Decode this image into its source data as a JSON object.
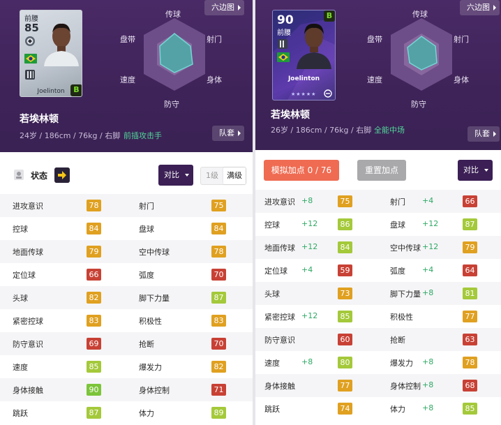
{
  "colors": {
    "hero_bg": "#3e2358",
    "role_green": "#52d69a",
    "boost_green": "#2ea864",
    "tier_red": "#c84135",
    "tier_orange": "#e0a020",
    "tier_yellow_green": "#a4c93a",
    "tier_green": "#7cc43a",
    "tier_teal": "#3cbf6e",
    "sim_button": "#ef6b52",
    "compare_button": "#3b1f55"
  },
  "left": {
    "hexagon_button": "六边图",
    "kit_button": "队套",
    "radar_labels": {
      "top": "传球",
      "top_left": "盘带",
      "top_right": "射门",
      "bottom_left": "速度",
      "bottom_right": "身体",
      "bottom": "防守"
    },
    "card": {
      "position": "前腰",
      "rating": "85",
      "name": "Joelinton",
      "badge": "B",
      "club_icon": "club-crest-icon",
      "flag_icon": "brazil-flag-icon"
    },
    "player_name": "若埃林顿",
    "meta": "24岁 / 186cm / 76kg / 右脚",
    "role": "前插攻击手",
    "state_label": "状态",
    "compare_label": "对比",
    "level_options": [
      "1级",
      "满级"
    ],
    "stats": [
      [
        {
          "name": "进攻意识",
          "value": "78",
          "tier": "#e0a020"
        },
        {
          "name": "射门",
          "value": "75",
          "tier": "#e0a020"
        }
      ],
      [
        {
          "name": "控球",
          "value": "84",
          "tier": "#e0a020"
        },
        {
          "name": "盘球",
          "value": "84",
          "tier": "#e0a020"
        }
      ],
      [
        {
          "name": "地面传球",
          "value": "79",
          "tier": "#e0a020"
        },
        {
          "name": "空中传球",
          "value": "78",
          "tier": "#e0a020"
        }
      ],
      [
        {
          "name": "定位球",
          "value": "66",
          "tier": "#c84135"
        },
        {
          "name": "弧度",
          "value": "70",
          "tier": "#c84135"
        }
      ],
      [
        {
          "name": "头球",
          "value": "82",
          "tier": "#e0a020"
        },
        {
          "name": "脚下力量",
          "value": "87",
          "tier": "#a4c93a"
        }
      ],
      [
        {
          "name": "紧密控球",
          "value": "83",
          "tier": "#e0a020"
        },
        {
          "name": "积极性",
          "value": "83",
          "tier": "#e0a020"
        }
      ],
      [
        {
          "name": "防守意识",
          "value": "69",
          "tier": "#c84135"
        },
        {
          "name": "抢断",
          "value": "70",
          "tier": "#c84135"
        }
      ],
      [
        {
          "name": "速度",
          "value": "85",
          "tier": "#a4c93a"
        },
        {
          "name": "爆发力",
          "value": "82",
          "tier": "#e0a020"
        }
      ],
      [
        {
          "name": "身体接触",
          "value": "90",
          "tier": "#7cc43a"
        },
        {
          "name": "身体控制",
          "value": "71",
          "tier": "#c84135"
        }
      ],
      [
        {
          "name": "跳跃",
          "value": "87",
          "tier": "#a4c93a"
        },
        {
          "name": "体力",
          "value": "89",
          "tier": "#a4c93a"
        }
      ]
    ]
  },
  "right": {
    "hexagon_button": "六边图",
    "kit_button": "队套",
    "radar_labels": {
      "top": "传球",
      "top_left": "盘带",
      "top_right": "射门",
      "bottom_left": "速度",
      "bottom_right": "身体",
      "bottom": "防守"
    },
    "card": {
      "position": "前腰",
      "rating": "90",
      "name": "Joelinton",
      "badge": "B",
      "stars": "★★★★★",
      "club_icon": "club-crest-icon",
      "flag_icon": "brazil-flag-icon"
    },
    "player_name": "若埃林顿",
    "meta": "26岁 / 186cm / 76kg / 右脚",
    "role": "全能中场",
    "sim_button": "模拟加点 0 / 76",
    "reset_button": "重置加点",
    "compare_label": "对比",
    "stats": [
      [
        {
          "name": "进攻意识",
          "boost": "+8",
          "value": "75",
          "tier": "#e0a020"
        },
        {
          "name": "射门",
          "boost": "+4",
          "value": "66",
          "tier": "#c84135"
        }
      ],
      [
        {
          "name": "控球",
          "boost": "+12",
          "value": "86",
          "tier": "#a4c93a"
        },
        {
          "name": "盘球",
          "boost": "+12",
          "value": "87",
          "tier": "#a4c93a"
        }
      ],
      [
        {
          "name": "地面传球",
          "boost": "+12",
          "value": "84",
          "tier": "#a4c93a"
        },
        {
          "name": "空中传球",
          "boost": "+12",
          "value": "79",
          "tier": "#e0a020"
        }
      ],
      [
        {
          "name": "定位球",
          "boost": "+4",
          "value": "59",
          "tier": "#c84135"
        },
        {
          "name": "弧度",
          "boost": "+4",
          "value": "64",
          "tier": "#c84135"
        }
      ],
      [
        {
          "name": "头球",
          "boost": "",
          "value": "73",
          "tier": "#e0a020"
        },
        {
          "name": "脚下力量",
          "boost": "+8",
          "value": "81",
          "tier": "#a4c93a"
        }
      ],
      [
        {
          "name": "紧密控球",
          "boost": "+12",
          "value": "85",
          "tier": "#a4c93a"
        },
        {
          "name": "积极性",
          "boost": "",
          "value": "77",
          "tier": "#e0a020"
        }
      ],
      [
        {
          "name": "防守意识",
          "boost": "",
          "value": "60",
          "tier": "#c84135"
        },
        {
          "name": "抢断",
          "boost": "",
          "value": "63",
          "tier": "#c84135"
        }
      ],
      [
        {
          "name": "速度",
          "boost": "+8",
          "value": "80",
          "tier": "#a4c93a"
        },
        {
          "name": "爆发力",
          "boost": "+8",
          "value": "78",
          "tier": "#e0a020"
        }
      ],
      [
        {
          "name": "身体接触",
          "boost": "",
          "value": "77",
          "tier": "#e0a020"
        },
        {
          "name": "身体控制",
          "boost": "+8",
          "value": "68",
          "tier": "#c84135"
        }
      ],
      [
        {
          "name": "跳跃",
          "boost": "",
          "value": "74",
          "tier": "#e0a020"
        },
        {
          "name": "体力",
          "boost": "+8",
          "value": "85",
          "tier": "#a4c93a"
        }
      ]
    ]
  }
}
